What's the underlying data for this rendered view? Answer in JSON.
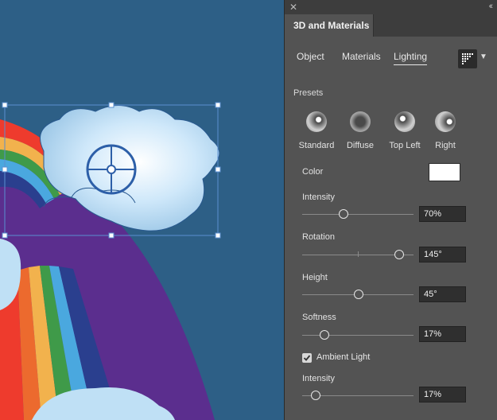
{
  "panel": {
    "title": "3D and Materials",
    "close_icon": "close-icon",
    "collapse_icon": "double-chevron-icon",
    "subtabs": [
      {
        "label": "Object",
        "active": false
      },
      {
        "label": "Materials",
        "active": false
      },
      {
        "label": "Lighting",
        "active": true
      }
    ],
    "render_icon": "render-settings-icon",
    "presets_title": "Presets",
    "presets": [
      {
        "label": "Standard"
      },
      {
        "label": "Diffuse"
      },
      {
        "label": "Top Left"
      },
      {
        "label": "Right"
      }
    ],
    "color": {
      "label": "Color",
      "value": "#ffffff"
    },
    "intensity": {
      "label": "Intensity",
      "value": "70%",
      "fraction": 0.38
    },
    "rotation": {
      "label": "Rotation",
      "value": "145°",
      "fraction": 0.9
    },
    "height": {
      "label": "Height",
      "value": "45°",
      "fraction": 0.5
    },
    "softness": {
      "label": "Softness",
      "value": "17%",
      "fraction": 0.17
    },
    "ambient": {
      "label": "Ambient Light",
      "checked": true
    },
    "ambient_intensity": {
      "label": "Intensity",
      "value": "17%",
      "fraction": 0.12
    }
  },
  "canvas": {
    "background": "#2d5f86",
    "rainbow_colors": [
      "#ee3b2d",
      "#ec6a2e",
      "#f2b24d",
      "#3f9a49",
      "#4aa8df",
      "#2a3f8e",
      "#5b2e8e"
    ],
    "cloud_color": "#bfe0f5",
    "selection_color": "#5a8fd0"
  }
}
